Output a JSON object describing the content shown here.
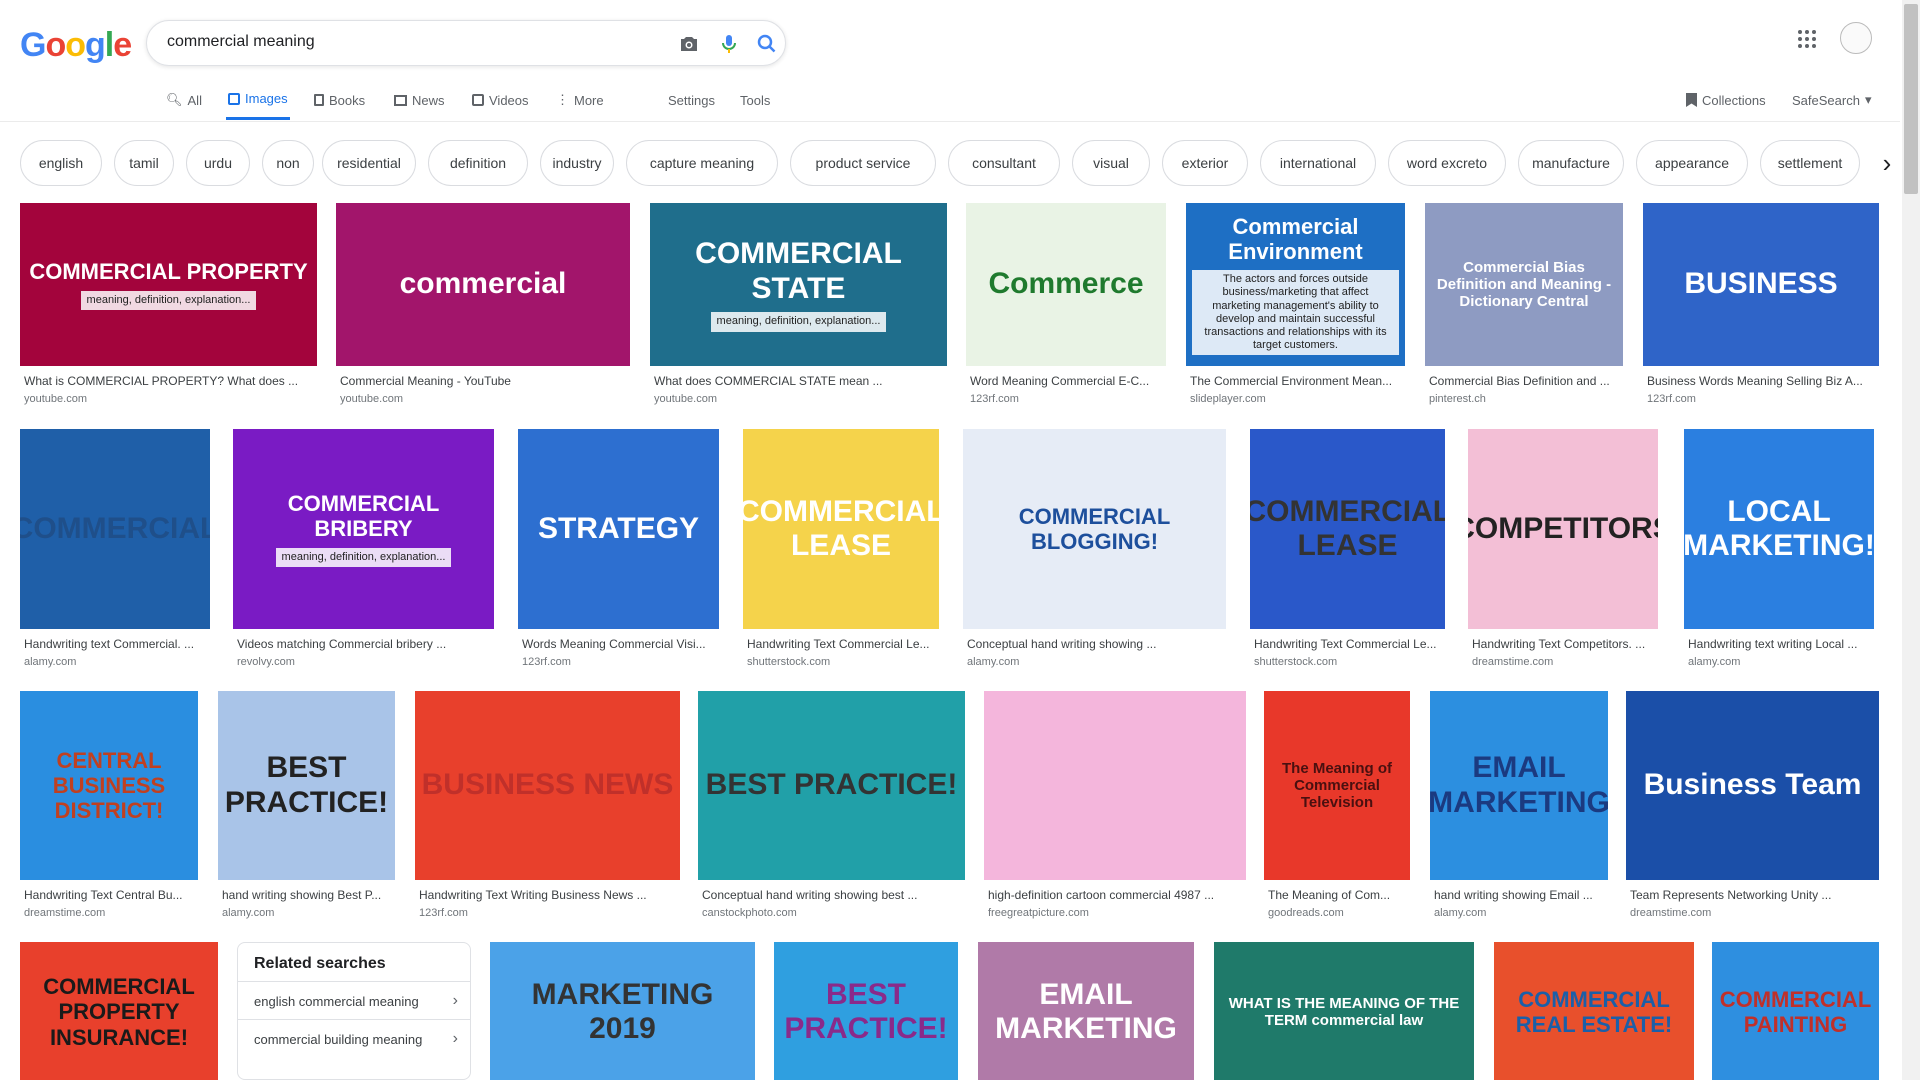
{
  "header": {
    "logo_letters": [
      {
        "ch": "G",
        "color": "#4285f4"
      },
      {
        "ch": "o",
        "color": "#ea4335"
      },
      {
        "ch": "o",
        "color": "#fbbc05"
      },
      {
        "ch": "g",
        "color": "#4285f4"
      },
      {
        "ch": "l",
        "color": "#34a853"
      },
      {
        "ch": "e",
        "color": "#ea4335"
      }
    ],
    "query": "commercial meaning"
  },
  "nav": {
    "all": "All",
    "images": "Images",
    "books": "Books",
    "news": "News",
    "videos": "Videos",
    "more": "More",
    "settings": "Settings",
    "tools": "Tools",
    "collections": "Collections",
    "safesearch": "SafeSearch"
  },
  "chips": [
    "english",
    "tamil",
    "urdu",
    "non",
    "residential",
    "definition",
    "industry",
    "capture meaning",
    "product service",
    "consultant",
    "visual",
    "exterior",
    "international",
    "word excreto",
    "manufacture",
    "appearance",
    "settlement"
  ],
  "results": [
    {
      "caption": "What is COMMERCIAL PROPERTY? What does ...",
      "source": "youtube.com",
      "thumb_text": "COMMERCIAL PROPERTY",
      "thumb_sub": "meaning, definition, explanation...",
      "bg": "#a3043c",
      "fg": "#ffffff"
    },
    {
      "caption": "Commercial Meaning - YouTube",
      "source": "youtube.com",
      "thumb_text": "commercial",
      "thumb_sub": "",
      "bg": "#a2156b",
      "fg": "#ffffff"
    },
    {
      "caption": "What does COMMERCIAL STATE mean ...",
      "source": "youtube.com",
      "thumb_text": "COMMERCIAL STATE",
      "thumb_sub": "meaning, definition, explanation...",
      "bg": "#1f6e8c",
      "fg": "#ffffff"
    },
    {
      "caption": "Word Meaning Commercial E-C...",
      "source": "123rf.com",
      "thumb_text": "Commerce",
      "thumb_sub": "",
      "bg": "#e9f3e5",
      "fg": "#1f7a2e"
    },
    {
      "caption": "The Commercial Environment Mean...",
      "source": "slideplayer.com",
      "thumb_text": "Commercial Environment",
      "thumb_sub": "The actors and forces outside business/marketing that affect marketing management's ability to develop and maintain successful transactions and relationships with its target customers.",
      "bg": "#1e6fc4",
      "fg": "#ffffff"
    },
    {
      "caption": "Commercial Bias Definition and ...",
      "source": "pinterest.ch",
      "thumb_text": "Commercial Bias Definition and Meaning - Dictionary Central",
      "thumb_sub": "",
      "bg": "#8e9bc2",
      "fg": "#ffffff"
    },
    {
      "caption": "Business Words Meaning Selling Biz A...",
      "source": "123rf.com",
      "thumb_text": "BUSINESS",
      "thumb_sub": "",
      "bg": "#2f64c8",
      "fg": "#ffffff"
    },
    {
      "caption": "Handwriting text Commercial. ...",
      "source": "alamy.com",
      "thumb_text": "COMMERCIAL",
      "thumb_sub": "",
      "bg": "#1f5fa8",
      "fg": "#1f4f8a"
    },
    {
      "caption": "Videos matching Commercial bribery ...",
      "source": "revolvy.com",
      "thumb_text": "COMMERCIAL BRIBERY",
      "thumb_sub": "meaning, definition, explanation...",
      "bg": "#7a1bc4",
      "fg": "#ffffff"
    },
    {
      "caption": "Words Meaning Commercial Visi...",
      "source": "123rf.com",
      "thumb_text": "STRATEGY",
      "thumb_sub": "",
      "bg": "#2d6fd0",
      "fg": "#ffffff"
    },
    {
      "caption": "Handwriting Text Commercial Le...",
      "source": "shutterstock.com",
      "thumb_text": "COMMERCIAL LEASE",
      "thumb_sub": "",
      "bg": "#f5d34b",
      "fg": "#ffffff"
    },
    {
      "caption": "Conceptual hand writing showing ...",
      "source": "alamy.com",
      "thumb_text": "COMMERCIAL BLOGGING!",
      "thumb_sub": "",
      "bg": "#e6ecf6",
      "fg": "#1d4f9c"
    },
    {
      "caption": "Handwriting Text Commercial Le...",
      "source": "shutterstock.com",
      "thumb_text": "COMMERCIAL LEASE",
      "thumb_sub": "",
      "bg": "#2a58c9",
      "fg": "#333333"
    },
    {
      "caption": "Handwriting Text Competitors. ...",
      "source": "dreamstime.com",
      "thumb_text": "COMPETITORS",
      "thumb_sub": "",
      "bg": "#f3bfd6",
      "fg": "#222222"
    },
    {
      "caption": "Handwriting text writing Local ...",
      "source": "alamy.com",
      "thumb_text": "LOCAL MARKETING!",
      "thumb_sub": "",
      "bg": "#2b7fe0",
      "fg": "#ffffff"
    },
    {
      "caption": "Handwriting Text Central Bu...",
      "source": "dreamstime.com",
      "thumb_text": "CENTRAL BUSINESS DISTRICT!",
      "thumb_sub": "",
      "bg": "#2a8ee0",
      "fg": "#c04020"
    },
    {
      "caption": "hand writing showing Best P...",
      "source": "alamy.com",
      "thumb_text": "BEST PRACTICE!",
      "thumb_sub": "",
      "bg": "#a9c4e8",
      "fg": "#222222"
    },
    {
      "caption": "Handwriting Text Writing Business News ...",
      "source": "123rf.com",
      "thumb_text": "BUSINESS NEWS",
      "thumb_sub": "",
      "bg": "#e8402c",
      "fg": "#c0302a"
    },
    {
      "caption": "Conceptual hand writing showing best ...",
      "source": "canstockphoto.com",
      "thumb_text": "BEST PRACTICE!",
      "thumb_sub": "",
      "bg": "#21a0a8",
      "fg": "#333333"
    },
    {
      "caption": "high-definition cartoon commercial 4987 ...",
      "source": "freegreatpicture.com",
      "thumb_text": "",
      "thumb_sub": "",
      "bg": "#f4b6dc",
      "fg": "#ffffff"
    },
    {
      "caption": "The Meaning of Com...",
      "source": "goodreads.com",
      "thumb_text": "The Meaning of Commercial Television",
      "thumb_sub": "",
      "bg": "#e8382a",
      "fg": "#4a1010"
    },
    {
      "caption": "hand writing showing Email ...",
      "source": "alamy.com",
      "thumb_text": "EMAIL MARKETING",
      "thumb_sub": "",
      "bg": "#2c8fe0",
      "fg": "#1b3a80"
    },
    {
      "caption": "Team Represents Networking Unity ...",
      "source": "dreamstime.com",
      "thumb_text": "Business Team",
      "thumb_sub": "",
      "bg": "#1b4fa8",
      "fg": "#ffffff"
    },
    {
      "caption": "",
      "source": "",
      "thumb_text": "COMMERCIAL PROPERTY INSURANCE!",
      "thumb_sub": "",
      "bg": "#e8402c",
      "fg": "#1a1a1a"
    },
    {
      "caption": "",
      "source": "",
      "thumb_text": "MARKETING 2019",
      "thumb_sub": "",
      "bg": "#4ba2e8",
      "fg": "#333333"
    },
    {
      "caption": "",
      "source": "",
      "thumb_text": "BEST PRACTICE!",
      "thumb_sub": "",
      "bg": "#2f9fe0",
      "fg": "#8a2a8a"
    },
    {
      "caption": "",
      "source": "",
      "thumb_text": "EMAIL MARKETING",
      "thumb_sub": "",
      "bg": "#b07aa8",
      "fg": "#ffffff"
    },
    {
      "caption": "",
      "source": "",
      "thumb_text": "WHAT IS THE MEANING OF THE TERM commercial law",
      "thumb_sub": "",
      "bg": "#1f7a6a",
      "fg": "#ffffff"
    },
    {
      "caption": "",
      "source": "",
      "thumb_text": "COMMERCIAL REAL ESTATE!",
      "thumb_sub": "",
      "bg": "#e8502c",
      "fg": "#1b5fa8"
    },
    {
      "caption": "",
      "source": "",
      "thumb_text": "COMMERCIAL PAINTING",
      "thumb_sub": "",
      "bg": "#2e8fe0",
      "fg": "#c0302a"
    }
  ],
  "related": {
    "title": "Related searches",
    "items": [
      "english commercial meaning",
      "commercial building meaning"
    ]
  }
}
